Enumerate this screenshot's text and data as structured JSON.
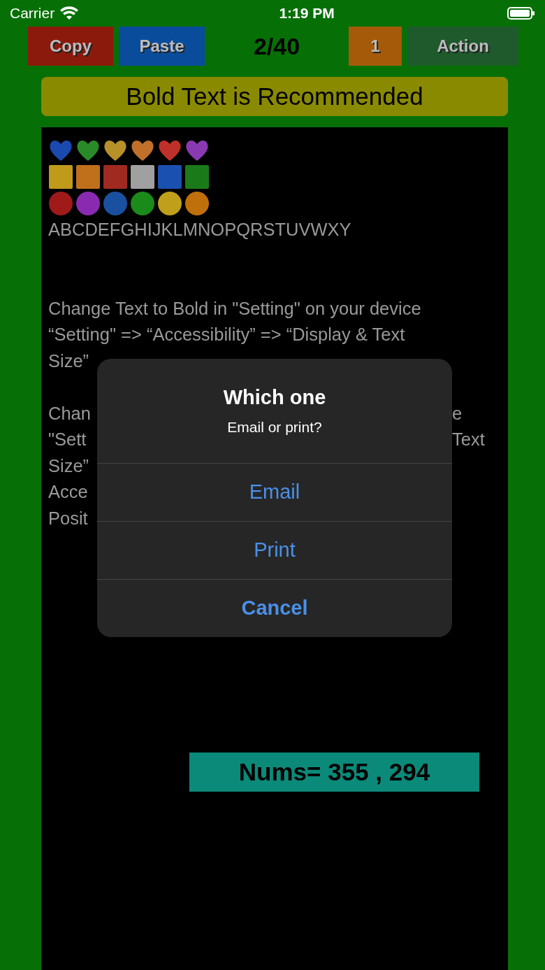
{
  "status_bar": {
    "carrier": "Carrier",
    "time": "1:19 PM"
  },
  "toolbar": [
    {
      "kind": "button",
      "label": "Copy",
      "color": "#8c1a0c"
    },
    {
      "kind": "button",
      "label": "Paste",
      "color": "#0a4c9c"
    },
    {
      "kind": "counter",
      "label": "2/40"
    },
    {
      "kind": "button",
      "label": "1",
      "color": "#a55a0a"
    },
    {
      "kind": "button",
      "label": "Action",
      "color": "#1e5a2c"
    }
  ],
  "banner": "Bold Text is Recommended",
  "hearts": [
    {
      "color": "#1a4ab0"
    },
    {
      "color": "#2a8a2a"
    },
    {
      "color": "#b8902a"
    },
    {
      "color": "#c0702a"
    },
    {
      "color": "#c0302a"
    },
    {
      "color": "#8a3ab0"
    }
  ],
  "squares": [
    {
      "color": "#c09a1a"
    },
    {
      "color": "#c0701a"
    },
    {
      "color": "#a02a20"
    },
    {
      "color": "#a0a0a0"
    },
    {
      "color": "#1a50b0"
    },
    {
      "color": "#1a7a1a"
    }
  ],
  "circles": [
    {
      "color": "#a01a1a"
    },
    {
      "color": "#8a2ab0"
    },
    {
      "color": "#1a50a0"
    },
    {
      "color": "#1a8a1a"
    },
    {
      "color": "#c0a01a"
    },
    {
      "color": "#c0700a"
    }
  ],
  "alphabet": "ABCDEFGHIJKLMNOPQRSTUVWXY",
  "paragraph_1": [
    "Change Text to Bold in \"Setting\" on your device",
    "“Setting\" => “Accessibility” => “Display & Text",
    "Size”"
  ],
  "paragraph_2": [
    {
      "left": "Chan",
      "right": "e"
    },
    {
      "left": "\"Sett",
      "right": "Text"
    },
    {
      "left": "Size”"
    },
    {
      "left": "Acce"
    },
    {
      "left": "Posit"
    }
  ],
  "nums": "Nums= 355 , 294",
  "alert": {
    "title": "Which one",
    "message": "Email or print?",
    "actions": [
      {
        "label": "Email",
        "kind": "default"
      },
      {
        "label": "Print",
        "kind": "default"
      },
      {
        "label": "Cancel",
        "kind": "cancel"
      }
    ]
  }
}
